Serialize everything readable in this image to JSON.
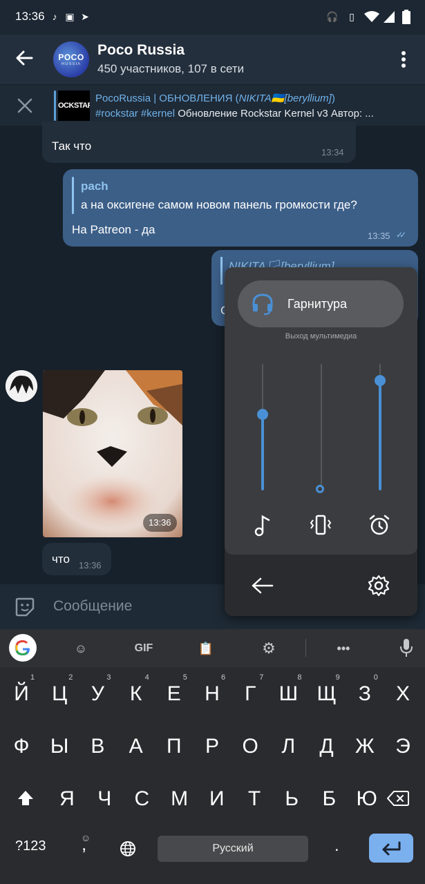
{
  "status_bar": {
    "time": "13:36"
  },
  "header": {
    "title": "Poco Russia",
    "subtitle": "450 участников, 107 в сети",
    "avatar_line1": "POCO",
    "avatar_line2": "RUSSIA"
  },
  "pinned": {
    "thumb_text": "OCKSTAR",
    "line1_channel": "PocoRussia | ОБНОВЛЕНИЯ (",
    "line1_author": "NIKITA🇺🇦[beryllium]",
    "line1_end": ")",
    "line2_tags": "#rockstar #kernel",
    "line2_text": " Обновление Rockstar Kernel v3 Автор: ..."
  },
  "messages": {
    "m1": {
      "text": "Так что",
      "time": "13:34"
    },
    "m2": {
      "reply_name": "pach",
      "reply_text": "а на оксигене самом новом панель громкости где?",
      "text": "На Patreon - да",
      "time": "13:35"
    },
    "m3": {
      "reply_text": "NIKITA🏳[beryllium]",
      "text": "С"
    },
    "m4": {
      "time": "13:36"
    },
    "m5": {
      "text": "что",
      "time": "13:36"
    }
  },
  "input": {
    "placeholder": "Сообщение"
  },
  "volume_panel": {
    "output_label": "Гарнитура",
    "output_sublabel": "Выход мультимедиа",
    "levels": {
      "music": 0.6,
      "notification": 0.0,
      "alarm": 0.87
    },
    "accent": "#4a90d6"
  },
  "keyboard": {
    "toolbar_gif": "GIF",
    "row1": [
      {
        "k": "Й",
        "n": "1"
      },
      {
        "k": "Ц",
        "n": "2"
      },
      {
        "k": "У",
        "n": "3"
      },
      {
        "k": "К",
        "n": "4"
      },
      {
        "k": "Е",
        "n": "5"
      },
      {
        "k": "Н",
        "n": "6"
      },
      {
        "k": "Г",
        "n": "7"
      },
      {
        "k": "Ш",
        "n": "8"
      },
      {
        "k": "Щ",
        "n": "9"
      },
      {
        "k": "З",
        "n": "0"
      },
      {
        "k": "Х",
        "n": ""
      }
    ],
    "row2": [
      "Ф",
      "Ы",
      "В",
      "А",
      "П",
      "Р",
      "О",
      "Л",
      "Д",
      "Ж",
      "Э"
    ],
    "row3": [
      "Я",
      "Ч",
      "С",
      "М",
      "И",
      "Т",
      "Ь",
      "Б",
      "Ю"
    ],
    "num_key": "?123",
    "comma_key": ",",
    "space_label": "Русский",
    "period_key": "."
  }
}
